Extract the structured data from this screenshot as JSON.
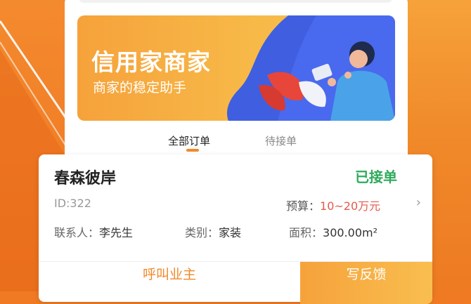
{
  "banner": {
    "title": "信用家商家",
    "subtitle": "商家的稳定助手"
  },
  "tabs": [
    {
      "label": "全部订单",
      "active": true
    },
    {
      "label": "待接单",
      "active": false
    }
  ],
  "order": {
    "name": "春森彼岸",
    "status": "已接单",
    "id_text": "ID:322",
    "budget_label": "预算：",
    "budget_value": "10~20万元",
    "contact_label": "联系人：",
    "contact_value": "李先生",
    "category_label": "类别：",
    "category_value": "家装",
    "area_label": "面积：",
    "area_value": "300.00m²",
    "call_label": "呼叫业主",
    "feedback_label": "写反馈"
  },
  "colors": {
    "background": "#ef7a23",
    "accent": "#f08a2a",
    "status_green": "#2eaa5b",
    "budget_red": "#e45a4d"
  },
  "icons": [
    "chevron-right-icon"
  ]
}
